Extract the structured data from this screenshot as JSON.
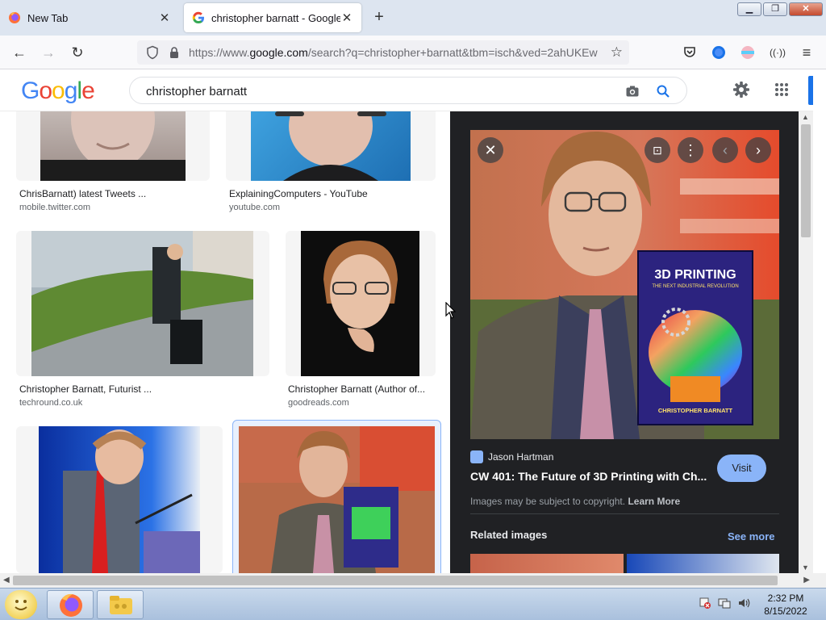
{
  "browser": {
    "tabs": [
      {
        "title": "New Tab",
        "active": false
      },
      {
        "title": "christopher barnatt - Google Se",
        "active": true
      }
    ],
    "url_prefix": "https://www.",
    "url_domain": "google.com",
    "url_rest": "/search?q=christopher+barnatt&tbm=isch&ved=2ahUKEw"
  },
  "google": {
    "search_query": "christopher barnatt",
    "logo_letters": [
      "G",
      "o",
      "o",
      "g",
      "l",
      "e"
    ],
    "logo_colors": [
      "#4285f4",
      "#ea4335",
      "#fbbc05",
      "#4285f4",
      "#34a853",
      "#ea4335"
    ]
  },
  "results": [
    {
      "title": "ChrisBarnatt) latest Tweets ...",
      "source": "mobile.twitter.com"
    },
    {
      "title": "ExplainingComputers - YouTube",
      "source": "youtube.com"
    },
    {
      "title": "Christopher Barnatt, Futurist ...",
      "source": "techround.co.uk"
    },
    {
      "title": "Christopher Barnatt (Author of...",
      "source": "goodreads.com"
    }
  ],
  "preview": {
    "source_name": "Jason Hartman",
    "title": "CW 401: The Future of 3D Printing with Ch...",
    "visit_label": "Visit",
    "copyright_text": "Images may be subject to copyright.",
    "learn_more": "Learn More",
    "related_heading": "Related images",
    "see_more": "See more",
    "book": {
      "title": "3D PRINTING",
      "subtitle": "THE NEXT INDUSTRIAL REVOLUTION",
      "author": "CHRISTOPHER BARNATT"
    }
  },
  "taskbar": {
    "time": "2:32 PM",
    "date": "8/15/2022"
  },
  "colors": {
    "google_blue": "#1a73e8",
    "preview_bg": "#202124",
    "visit_button": "#8ab4f8"
  }
}
